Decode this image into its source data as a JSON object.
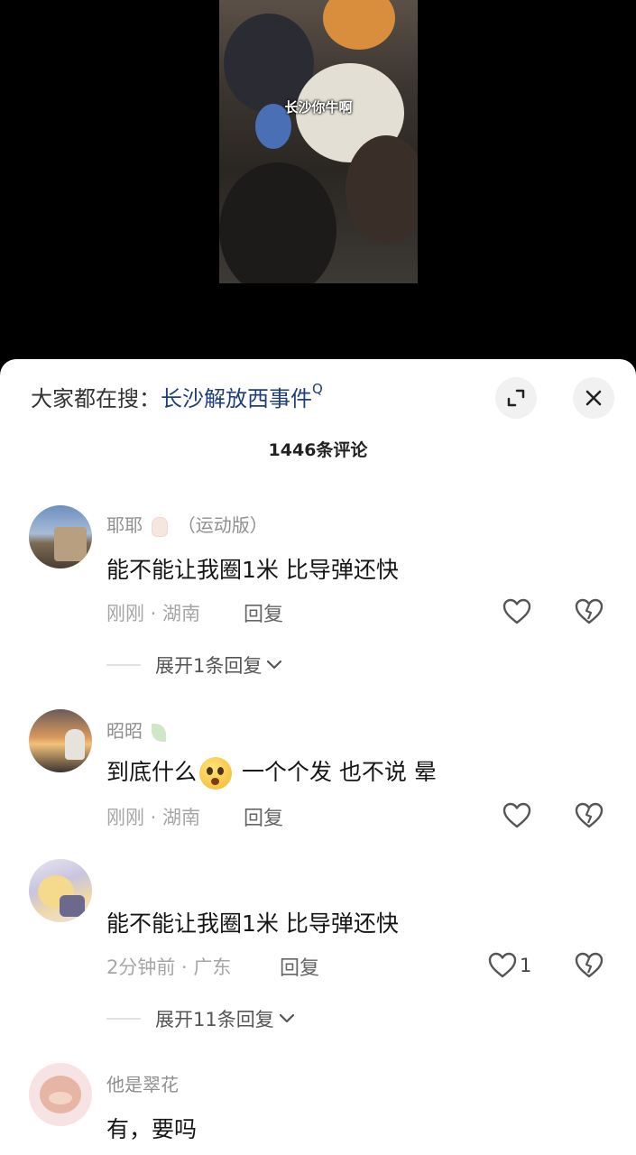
{
  "video": {
    "caption": "长沙你牛啊"
  },
  "search": {
    "label": "大家都在搜：",
    "term": "长沙解放西事件",
    "q": "Q"
  },
  "comments_count": "1446条评论",
  "colors": {
    "link": "#1f3f77",
    "sheet": "#ffffff",
    "meta": "#a6a6a6"
  },
  "comments": [
    {
      "name": "耶耶",
      "name_suffix": "（运动版）",
      "text": "能不能让我圈1米 比导弹还快",
      "meta": "刚刚 · 湖南",
      "reply": "回复",
      "expand": "展开1条回复",
      "avatar_icon": "avatar-icon"
    },
    {
      "name": "昭昭",
      "text_before": "到底什么",
      "emoji": "shocked-face-emoji",
      "text_after": " 一个个发 也不说 晕",
      "meta": "刚刚 · 湖南",
      "reply": "回复",
      "avatar_icon": "avatar-icon"
    },
    {
      "name": "",
      "text": "能不能让我圈1米 比导弹还快",
      "meta": "2分钟前 · 广东",
      "reply": "回复",
      "likes": "1",
      "expand": "展开11条回复",
      "avatar_icon": "avatar-icon"
    },
    {
      "name": "他是翠花",
      "text": "有，要吗",
      "avatar_icon": "avatar-icon"
    }
  ]
}
